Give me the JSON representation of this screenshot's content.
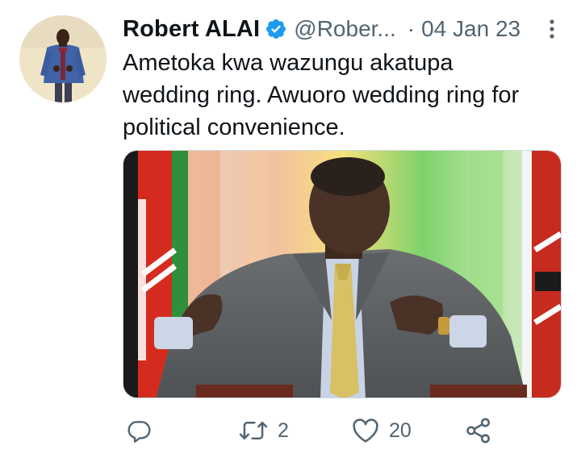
{
  "tweet": {
    "author": {
      "display_name": "Robert ALAI",
      "handle": "@Rober...",
      "verified_icon": "verified-badge-icon"
    },
    "separator": "·",
    "date": "04 Jan 23",
    "text_lines": [
      "Ametoka kwa wazungu akatupa",
      "wedding ring. Awuoro wedding ring for",
      "political convenience."
    ],
    "media": {
      "kind": "photo"
    },
    "actions": {
      "reply": {
        "icon": "reply-icon",
        "count": ""
      },
      "retweet": {
        "icon": "retweet-icon",
        "count": "2"
      },
      "like": {
        "icon": "heart-icon",
        "count": "20"
      },
      "share": {
        "icon": "share-icon"
      }
    },
    "more_icon": "more-options-icon"
  },
  "colors": {
    "text_primary": "#0f1419",
    "text_secondary": "#536471",
    "verified_blue": "#1d9bf0",
    "border": "#cfd9de"
  }
}
